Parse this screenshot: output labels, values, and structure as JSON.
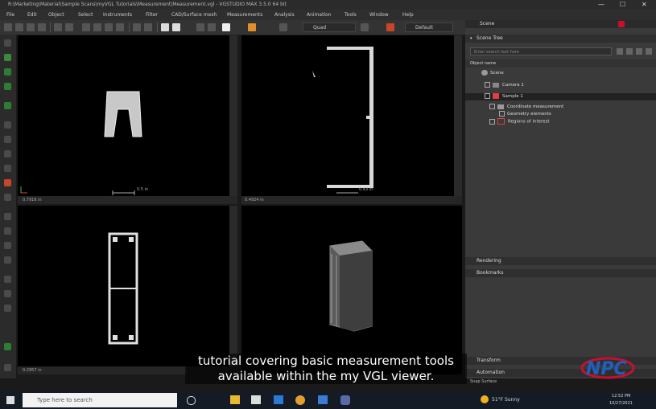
{
  "window": {
    "title": "R:\\Marketing\\Material\\Sample Scans\\myVGL Tutorials\\Measurement\\Measurement.vgl - VGSTUDIO MAX 3.5.0 64 bit",
    "controls": [
      "—",
      "☐",
      "✕"
    ]
  },
  "menu": [
    "File",
    "Edit",
    "Object",
    "Select",
    "Instruments",
    "Filter",
    "CAD/Surface mesh",
    "Measurements",
    "Analysis",
    "Animation",
    "Tools",
    "Window",
    "Help"
  ],
  "toolbar": {
    "render_mode": "Quad",
    "default_label": "Default"
  },
  "viewports": {
    "top_left": {
      "scale_label": "0.5 in",
      "zoom": "0.7916 in"
    },
    "top_right": {
      "scale_label": "0.43 in",
      "zoom": "0.4924 in"
    },
    "bottom_left": {
      "scale_label": "",
      "zoom": "0.2957 in"
    }
  },
  "panel": {
    "scene_tab": "Scene",
    "scene_tree_label": "Scene Tree",
    "search_placeholder": "Enter search text here",
    "object_name_label": "Object name",
    "items": [
      {
        "label": "Scene"
      },
      {
        "label": "Camera 1"
      },
      {
        "label": "Sample 1"
      },
      {
        "label": "Coordinate measurement"
      },
      {
        "label": "Geometry elements"
      },
      {
        "label": "Regions of interest"
      }
    ],
    "rendering_label": "Rendering",
    "bookmarks_label": "Bookmarks",
    "transform_label": "Transform",
    "automation_label": "Automation",
    "snap_surface_label": "Snap Surface"
  },
  "subtitle": {
    "line1": "tutorial covering basic measurement tools",
    "line2": "available within the my VGL viewer."
  },
  "watermark": "NPC",
  "taskbar": {
    "search_placeholder": "Type here to search",
    "weather": "51°F  Sunny",
    "time": "12:52 PM",
    "date": "10/27/2021"
  },
  "colors": {
    "accent_red": "#c8102e",
    "accent_blue": "#1f5fbf",
    "sample_red": "#e04040"
  }
}
